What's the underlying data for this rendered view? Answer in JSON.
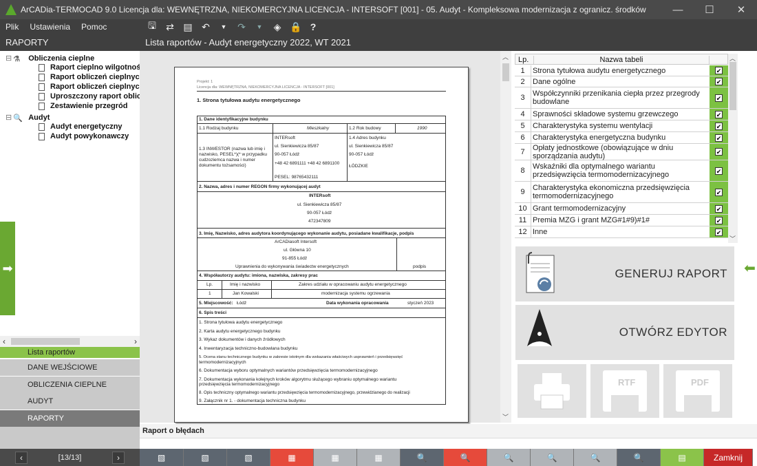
{
  "window": {
    "title": "ArCADia-TERMOCAD 9.0 Licencja dla: WEWNĘTRZNA, NIEKOMERCYJNA LICENCJA - INTERSOFT [001] - 05. Audyt - Kompleksowa modernizacja z ogranicz. środków",
    "minimize": "—",
    "maximize": "☐",
    "close": "✕"
  },
  "menu": [
    "Plik",
    "Ustawienia",
    "Pomoc"
  ],
  "sidebar": {
    "header": "RAPORTY",
    "tree": [
      {
        "label": "Obliczenia cieplne",
        "level": 0
      },
      {
        "label": "Raport cieplno wilgotnoś",
        "level": 1
      },
      {
        "label": "Raport obliczeń cieplnych",
        "level": 1
      },
      {
        "label": "Raport obliczeń cieplnych",
        "level": 1
      },
      {
        "label": "Uproszczony raport oblic",
        "level": 1
      },
      {
        "label": "Zestawienie przegród",
        "level": 1
      },
      {
        "label": "Audyt",
        "level": 0
      },
      {
        "label": "Audyt energetyczny",
        "level": 1
      },
      {
        "label": "Audyt powykonawczy",
        "level": 1
      }
    ],
    "nav": [
      "Lista raportów",
      "DANE WEJŚCIOWE",
      "OBLICZENIA CIEPLNE",
      "AUDYT",
      "RAPORTY"
    ],
    "pager": "[13/13]"
  },
  "main": {
    "header": "Lista raportów - Audyt energetyczny 2022, WT 2021",
    "error_label": "Raport o błędach"
  },
  "doc": {
    "proj": "Projekt: 1",
    "lic": "Licencja dla: WEWNĘTRZNA, NIEKOMERCYJNA LICENCJA - INTERSOFT [001]",
    "heading": "1. Strona tytułowa audytu energetycznego",
    "s1": "1. Dane identyfikacyjne budynku",
    "r11": "1.1 Rodzaj budynku",
    "r11v": "Mieszkalny",
    "r12": "1.2 Rok budowy",
    "r12v": "1990",
    "r13": "1.3 INWESTOR (nazwa lub imię i nazwisko, PESEL*)(* w przypadku cudzoziemca nazwa i numer dokumentu tożsamości)",
    "r13v": [
      "INTERsoft",
      "ul. Sienkiewicza 85/87",
      "90-057 Łódź",
      "+48 42 6891111 +48 42 6891100",
      "PESEL: 98765432111"
    ],
    "r14": "1.4 Adres budynku",
    "r14v": [
      "ul. Sienkiewicza 85/87",
      "90-057 Łódź",
      "",
      "ŁÓDZKIE"
    ],
    "s2": "2. Nazwa, adres i numer REGON firmy wykonującej audyt",
    "s2v": [
      "INTERsoft",
      "ul. Sienkiewicza 85/87",
      "90-057 Łódź",
      "472347809"
    ],
    "s3": "3. Imię, Nazwisko, adres audytora koordynującego wykonanie audytu, posiadane kwalifikacje, podpis",
    "s3v": [
      "ArCADiasoft Intersoft",
      "ul. Główna 10",
      "91-855 Łódź",
      "Uprawnienia do wykonywania świadectw energetycznych"
    ],
    "s3sig": "podpis",
    "s4": "4. Współautorzy audytu: imiona, nazwiska, zakresy prac",
    "s4h": [
      "Lp.",
      "Imię i nazwisko",
      "Zakres udziału w opracowaniu audytu energetycznego"
    ],
    "s4r": [
      "1",
      "Jan Kowalski",
      "modernizacja systemu ogrzewania"
    ],
    "s5": "5. Miejscowość:",
    "s5v": "Łódź",
    "s5d": "Data wykonania opracowania",
    "s5dv": "styczeń 2023",
    "s6": "6. Spis treści",
    "toc": [
      "1. Strona tytułowa audytu energetycznego",
      "2. Karta audytu energetycznego budynku",
      "3. Wykaz dokumentów i danych źródłowych",
      "4. Inwentaryzacja techniczno-budowlana budynku",
      "5. Ocena stanu technicznego budynku w zakresie istotnym dla wskazania właściwych usprawnień i przedsięwzięć",
      "termomodernizacyjnych",
      "6. Dokumentacja wyboru optymalnych wariantów przedsięwzięcia termomodernizacyjnego",
      "7. Dokumentacja wykonania kolejnych kroków algorytmu służącego wybraniu optymalnego wariantu",
      "przedsięwzięcia termomodernizacyjnego",
      "8. Opis techniczny optymalnego wariantu przedsięwzięcia termomodernizacyjnego, przewidzianego do realizacji",
      "9. Załącznik nr 1. - dokumentacja techniczna budynku"
    ]
  },
  "table": {
    "col_lp": "Lp.",
    "col_name": "Nazwa tabeli",
    "rows": [
      {
        "lp": "1",
        "name": "Strona tytułowa audytu energetycznego"
      },
      {
        "lp": "2",
        "name": "Dane ogólne"
      },
      {
        "lp": "3",
        "name": "Współczynniki przenikania ciepła przez przegrody budowlane"
      },
      {
        "lp": "4",
        "name": "Sprawności składowe systemu grzewczego"
      },
      {
        "lp": "5",
        "name": "Charakterystyka systemu wentylacji"
      },
      {
        "lp": "6",
        "name": "Charakterystyka energetyczna budynku"
      },
      {
        "lp": "7",
        "name": "Opłaty jednostkowe (obowiązujące w dniu sporządzania audytu)"
      },
      {
        "lp": "8",
        "name": "Wskaźniki dla optymalnego wariantu przedsięwzięcia termomodernizacyjnego"
      },
      {
        "lp": "9",
        "name": "Charakterystyka ekonomiczna przedsięwzięcia termomodernizacyjnego"
      },
      {
        "lp": "10",
        "name": "Grant termomodernizacyjny"
      },
      {
        "lp": "11",
        "name": "Premia MZG i grant MZG#1#9)#1#"
      },
      {
        "lp": "12",
        "name": "Inne"
      }
    ]
  },
  "actions": {
    "generate": "GENERUJ RAPORT",
    "editor": "OTWÓRZ EDYTOR",
    "rtf": "RTF",
    "pdf": "PDF"
  },
  "bottom": {
    "close": "Zamknij"
  }
}
